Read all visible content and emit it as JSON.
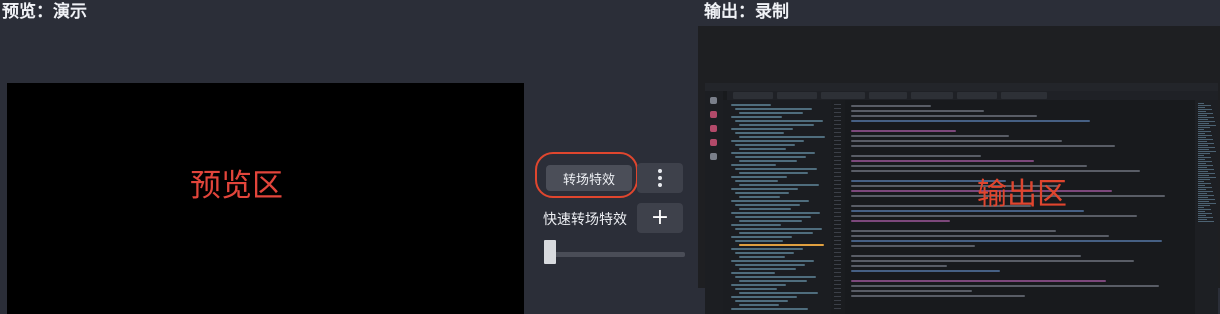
{
  "headers": {
    "preview": "预览：演示",
    "output": "输出：录制"
  },
  "preview": {
    "overlay_label": "预览区"
  },
  "transitions": {
    "transition_button_label": "转场特效",
    "more_icon": "kebab-menu-icon",
    "quick_transition_label": "快速转场特效",
    "add_icon_label": "+",
    "highlight_color": "#e0462e"
  },
  "output": {
    "overlay_label": "输出区"
  },
  "colors": {
    "background": "#2b2e38",
    "canvas": "#000000",
    "annotation": "#e2453b"
  }
}
